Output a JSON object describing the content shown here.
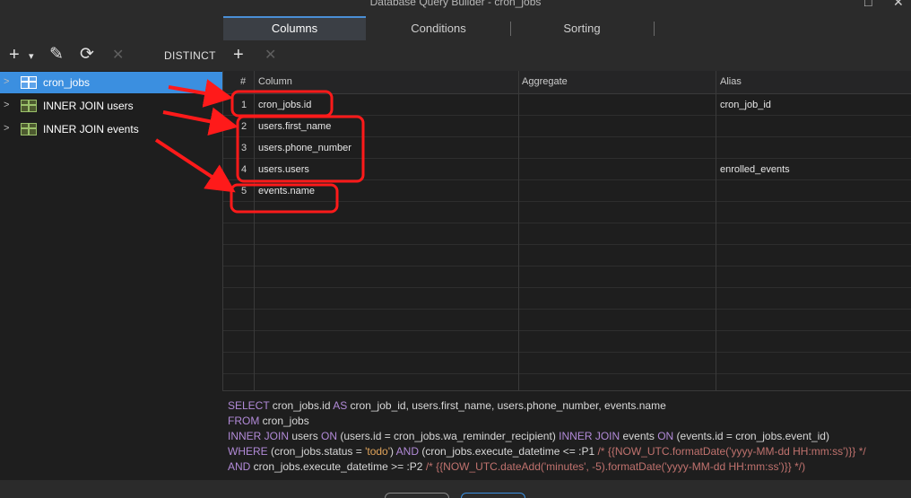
{
  "window": {
    "title": "Database Query Builder - cron_jobs",
    "controls": [
      "□",
      "✕"
    ]
  },
  "tabs": [
    {
      "label": "Columns",
      "active": true
    },
    {
      "label": "Conditions",
      "active": false
    },
    {
      "label": "Sorting",
      "active": false
    }
  ],
  "left_toolbar": {
    "add_icon": "+",
    "dropdown_icon": "▾",
    "edit_icon": "✎",
    "refresh_icon": "⟳",
    "delete_icon": "✕",
    "distinct_label": "DISTINCT"
  },
  "right_toolbar": {
    "add_icon": "+",
    "delete_icon": "✕"
  },
  "tree": {
    "items": [
      {
        "label": "cron_jobs",
        "selected": true,
        "chevron": ">"
      },
      {
        "label": "INNER JOIN users",
        "selected": false,
        "chevron": ">"
      },
      {
        "label": "INNER JOIN events",
        "selected": false,
        "chevron": ">"
      }
    ]
  },
  "grid": {
    "headers": {
      "num": "#",
      "column": "Column",
      "aggregate": "Aggregate",
      "alias": "Alias"
    },
    "rows": [
      {
        "num": "1",
        "column": "cron_jobs.id",
        "aggregate": "",
        "alias": "cron_job_id"
      },
      {
        "num": "2",
        "column": "users.first_name",
        "aggregate": "",
        "alias": ""
      },
      {
        "num": "3",
        "column": "users.phone_number",
        "aggregate": "",
        "alias": ""
      },
      {
        "num": "4",
        "column": "users.users",
        "aggregate": "",
        "alias": "enrolled_events"
      },
      {
        "num": "5",
        "column": "events.name",
        "aggregate": "",
        "alias": ""
      }
    ]
  },
  "sql": {
    "line1": {
      "kw1": "SELECT",
      "t1": " cron_jobs.id ",
      "kw2": "AS",
      "t2": " cron_job_id, users.first_name, users.phone_number, events.name"
    },
    "line2": {
      "kw1": "FROM",
      "t1": " cron_jobs"
    },
    "line3": {
      "kw1": "INNER JOIN",
      "t1": " users ",
      "kw2": "ON",
      "t2": " (users.id = cron_jobs.wa_reminder_recipient) ",
      "kw3": "INNER JOIN",
      "t3": " events ",
      "kw4": "ON",
      "t4": " (events.id = cron_jobs.event_id)"
    },
    "line4": {
      "kw1": "WHERE",
      "t1": " (cron_jobs.status = ",
      "s1": "'todo'",
      "t2": ") ",
      "kw2": "AND",
      "t3": " (cron_jobs.execute_datetime <= ",
      "p1": ":P1",
      "c1": " /* {{NOW_UTC.formatDate('yyyy-MM-dd HH:mm:ss')}} */"
    },
    "line5": {
      "kw1": "AND",
      "t1": " cron_jobs.execute_datetime >= ",
      "p1": ":P2",
      "c1": " /* {{NOW_UTC.dateAdd('minutes', -5).formatDate('yyyy-MM-dd HH:mm:ss')}} */)"
    }
  },
  "colors": {
    "accent": "#3b8fe0",
    "annotation_red": "#ff1a1a",
    "keyword": "#b28ad8",
    "string": "#e0a35a",
    "comment": "#c0726e",
    "table_icon": "#9ac06a"
  },
  "icons": [
    "plus-icon",
    "dropdown-arrow-icon",
    "pencil-icon",
    "refresh-icon",
    "close-icon",
    "chevron-right-icon",
    "table-icon"
  ]
}
